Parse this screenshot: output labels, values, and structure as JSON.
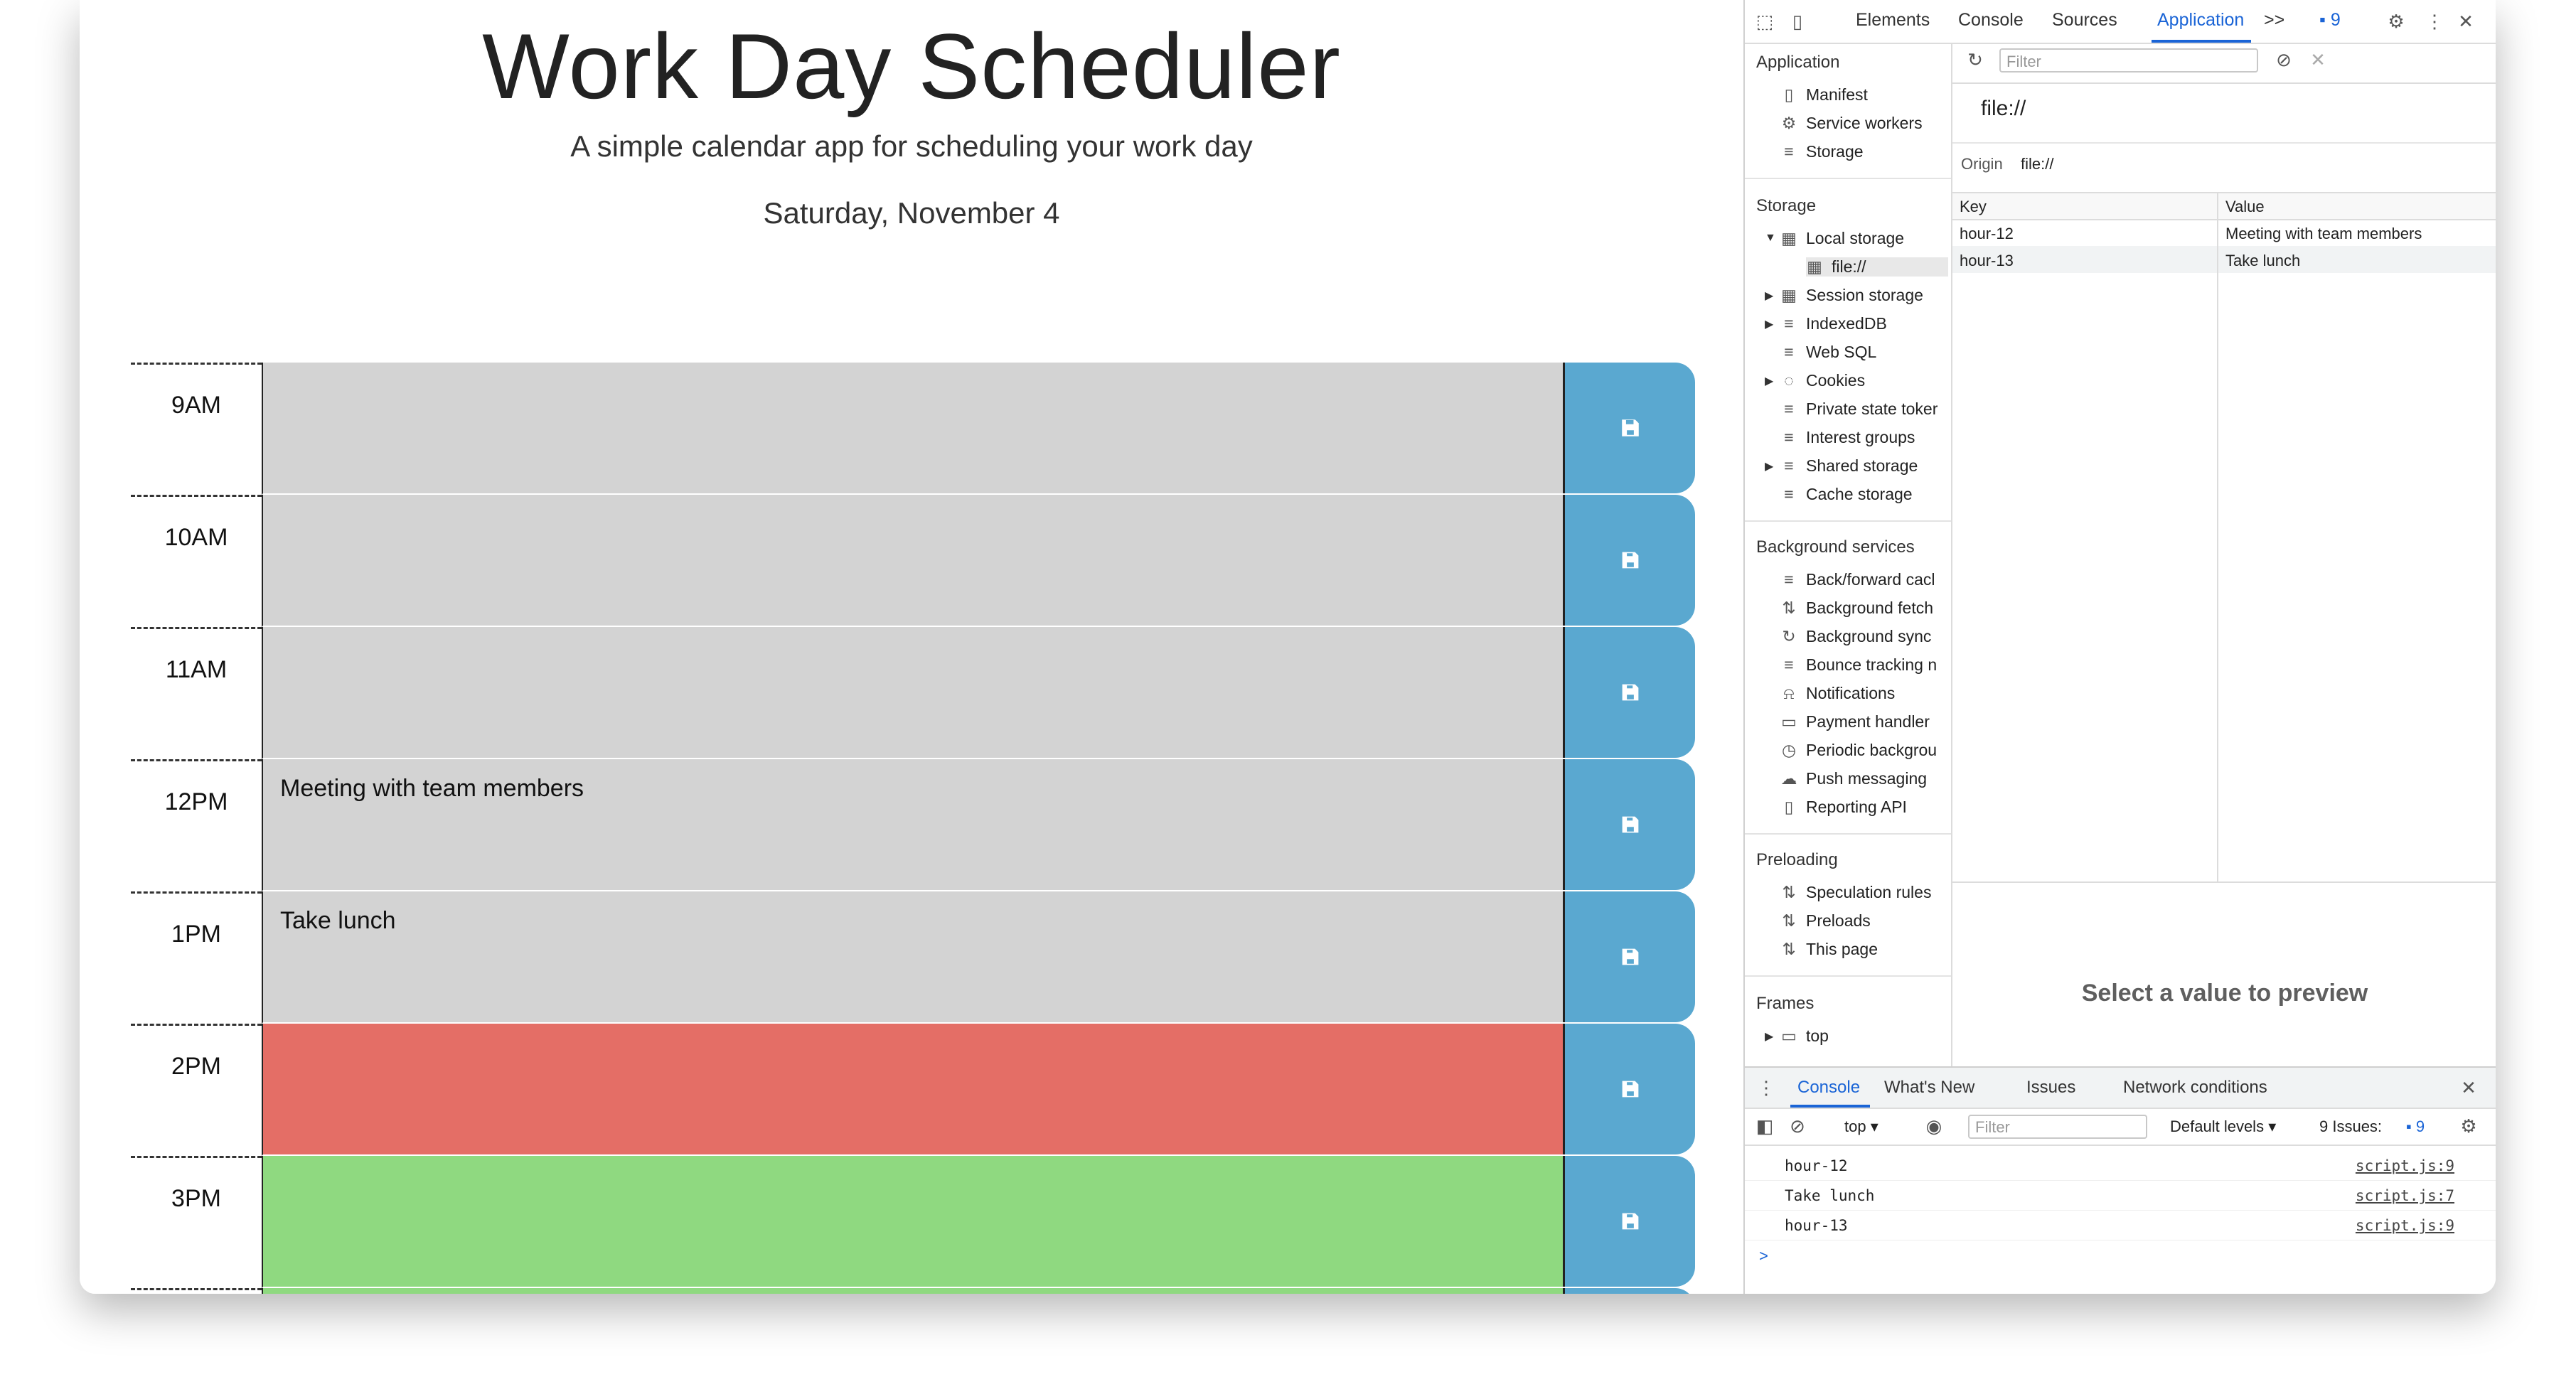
{
  "page": {
    "title": "Work Day Scheduler",
    "subtitle": "A simple calendar app for scheduling your work day",
    "date": "Saturday, November 4",
    "rows": [
      {
        "hour": "9AM",
        "text": "",
        "state": "past"
      },
      {
        "hour": "10AM",
        "text": "",
        "state": "past"
      },
      {
        "hour": "11AM",
        "text": "",
        "state": "past"
      },
      {
        "hour": "12PM",
        "text": "Meeting with team members",
        "state": "past"
      },
      {
        "hour": "1PM",
        "text": "Take lunch",
        "state": "past"
      },
      {
        "hour": "2PM",
        "text": "",
        "state": "present"
      },
      {
        "hour": "3PM",
        "text": "",
        "state": "future"
      }
    ],
    "colors": {
      "past": "#d3d3d3",
      "present": "#e46e66",
      "future": "#8fd980",
      "save": "#5aa8d0"
    }
  },
  "devtools": {
    "tabs": [
      "Elements",
      "Console",
      "Sources",
      "Application"
    ],
    "active_tab": "Application",
    "more": ">>",
    "issues_count": "9",
    "sidebar": {
      "application_header": "Application",
      "application_items": [
        "Manifest",
        "Service workers",
        "Storage"
      ],
      "storage_header": "Storage",
      "local_storage": "Local storage",
      "local_storage_child": "file://",
      "storage_items": [
        "Session storage",
        "IndexedDB",
        "Web SQL",
        "Cookies",
        "Private state toker",
        "Interest groups",
        "Shared storage",
        "Cache storage"
      ],
      "background_header": "Background services",
      "background_items": [
        "Back/forward cacl",
        "Background fetch",
        "Background sync",
        "Bounce tracking n",
        "Notifications",
        "Payment handler",
        "Periodic backgrou",
        "Push messaging",
        "Reporting API"
      ],
      "preloading_header": "Preloading",
      "preloading_items": [
        "Speculation rules",
        "Preloads",
        "This page"
      ],
      "frames_header": "Frames",
      "frames_item": "top"
    },
    "main": {
      "filter_placeholder": "Filter",
      "origin_title": "file://",
      "origin_label": "Origin",
      "origin_value": "file://",
      "columns": [
        "Key",
        "Value"
      ],
      "entries": [
        {
          "key": "hour-12",
          "value": "Meeting with team members"
        },
        {
          "key": "hour-13",
          "value": "Take lunch"
        }
      ],
      "preview_text": "Select a value to preview"
    },
    "console": {
      "tabs": [
        "Console",
        "What's New",
        "Issues",
        "Network conditions"
      ],
      "context": "top",
      "filter_placeholder": "Filter",
      "levels": "Default levels",
      "issues_label": "9 Issues:",
      "issues_count": "9",
      "lines": [
        {
          "msg": "hour-12",
          "src": "script.js:9"
        },
        {
          "msg": "Take lunch",
          "src": "script.js:7"
        },
        {
          "msg": "hour-13",
          "src": "script.js:9"
        }
      ],
      "prompt": ">"
    }
  }
}
